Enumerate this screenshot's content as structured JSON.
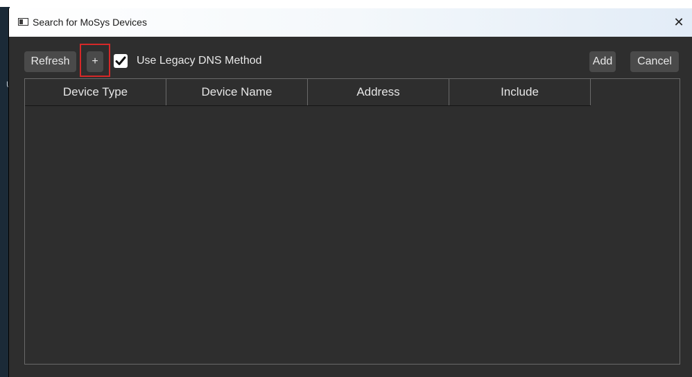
{
  "window": {
    "title": "Search for MoSys Devices",
    "close_glyph": "✕"
  },
  "toolbar": {
    "refresh_label": "Refresh",
    "plus_label": "+",
    "legacy_dns_label": "Use Legacy DNS Method",
    "legacy_dns_checked": true,
    "add_label": "Add",
    "cancel_label": "Cancel"
  },
  "table": {
    "columns": [
      "Device Type",
      "Device Name",
      "Address",
      "Include"
    ],
    "rows": []
  },
  "backdrop": {
    "glyph": "U"
  },
  "colors": {
    "dialog_bg": "#2e2e2e",
    "button_bg": "#4a4a4a",
    "highlight": "#d62828"
  },
  "icons": {
    "window": "window-app-icon",
    "close": "close-icon",
    "checkmark": "checkmark-icon"
  }
}
